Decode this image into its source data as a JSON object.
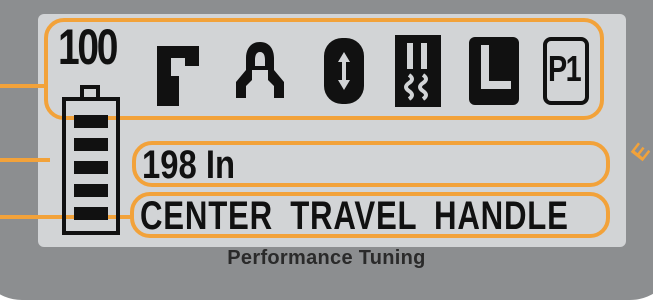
{
  "display": {
    "battery_percent": "100",
    "battery_bars": 5,
    "icons": [
      {
        "name": "wrench-icon"
      },
      {
        "name": "rider-icon"
      },
      {
        "name": "pressure-icon"
      },
      {
        "name": "damper-icon"
      },
      {
        "name": "lowered-icon"
      },
      {
        "name": "profile-icon",
        "label": "P1"
      }
    ],
    "distance_readout": "198 In",
    "mode_readout": "CENTER TRAVEL HANDLE"
  },
  "footer": {
    "caption": "Performance Tuning"
  },
  "side_label": "E",
  "colors": {
    "highlight": "#f2a23a",
    "bezel": "#8c8e90",
    "lcd": "#d2d4d6",
    "segment": "#111111"
  }
}
